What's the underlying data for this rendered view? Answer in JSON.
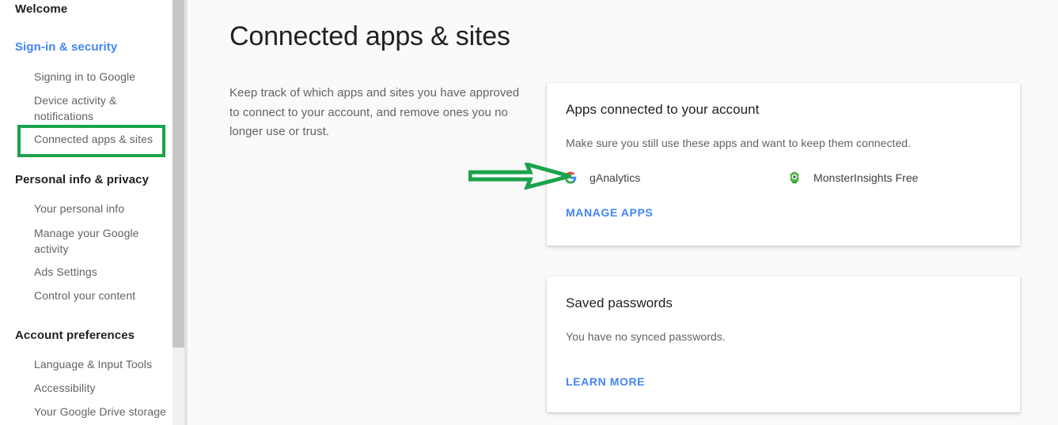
{
  "sidebar": {
    "welcome_label": "Welcome",
    "sections": [
      {
        "heading": "Sign-in & security",
        "accent": true,
        "items": [
          "Signing in to Google",
          "Device activity & notifications",
          "Connected apps & sites"
        ],
        "active_item": "Connected apps & sites"
      },
      {
        "heading": "Personal info & privacy",
        "accent": false,
        "items": [
          "Your personal info",
          "Manage your Google activity",
          "Ads Settings",
          "Control your content"
        ]
      },
      {
        "heading": "Account preferences",
        "accent": false,
        "items": [
          "Language & Input Tools",
          "Accessibility",
          "Your Google Drive storage"
        ]
      }
    ]
  },
  "main": {
    "title": "Connected apps & sites",
    "description": "Keep track of which apps and sites you have approved to connect to your account, and remove ones you no longer use or trust.",
    "cards": [
      {
        "title": "Apps connected to your account",
        "subtitle": "Make sure you still use these apps and want to keep them connected.",
        "apps": [
          {
            "name": "gAnalytics",
            "icon": "google-g-icon"
          },
          {
            "name": "MonsterInsights Free",
            "icon": "monster-icon"
          }
        ],
        "link": "MANAGE APPS"
      },
      {
        "title": "Saved passwords",
        "subtitle": "You have no synced passwords.",
        "link": "LEARN MORE"
      }
    ]
  },
  "annotations": {
    "highlight_target": "Connected apps & sites",
    "arrow_target": "gAnalytics",
    "color": "#1aa34a"
  },
  "colors": {
    "accent_blue": "#4285f4",
    "annotation_green": "#1aa34a",
    "text_primary": "#202124",
    "text_secondary": "#5f6368",
    "content_background": "#fafafa",
    "card_background": "#ffffff"
  },
  "scrollbar": {
    "thumb_color": "#c6c6c6",
    "track_color": "#f1f1f1"
  }
}
